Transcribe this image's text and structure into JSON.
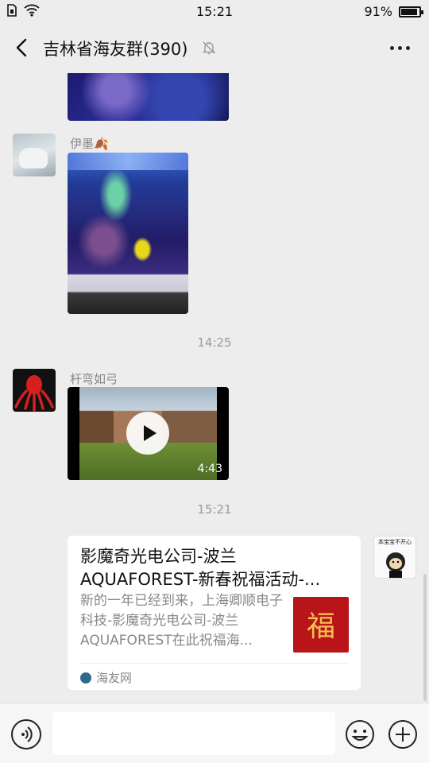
{
  "status": {
    "time": "15:21",
    "battery_text": "91%",
    "battery_level": 0.91
  },
  "nav": {
    "title": "吉林省海友群(390)",
    "icons": [
      "back-icon",
      "mute-bell-icon",
      "more-icon"
    ]
  },
  "messages": [
    {
      "type": "image",
      "sender_name": "",
      "description": "aquarium-photo"
    },
    {
      "type": "image",
      "sender_name": "伊墨",
      "sender_badge": "🍂",
      "description": "aquarium-photo"
    },
    {
      "type": "timestamp",
      "text": "14:25"
    },
    {
      "type": "video",
      "sender_name": "杆弯如弓",
      "duration": "4:43"
    },
    {
      "type": "timestamp",
      "text": "15:21"
    },
    {
      "type": "link",
      "title": "影魔奇光电公司-波兰AQUAFOREST-新春祝福活动-...",
      "description": "新的一年已经到来，上海卿顺电子科技-影魔奇光电公司-波兰AQUAFOREST在此祝福海...",
      "thumb_text": "福",
      "source": "海友网",
      "self_avatar_text": "本宝宝不开心"
    }
  ],
  "input": {
    "placeholder": "",
    "icons": [
      "voice-icon",
      "emoji-icon",
      "plus-icon"
    ]
  }
}
